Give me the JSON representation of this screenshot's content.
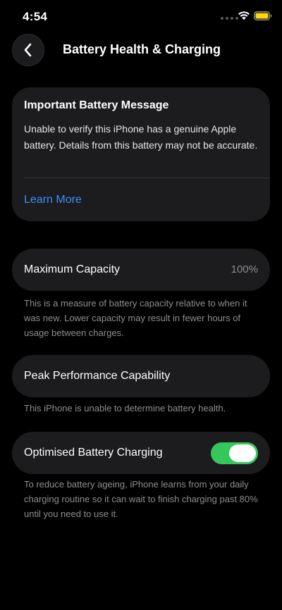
{
  "status_bar": {
    "time": "4:54",
    "wifi_icon": "wifi-icon",
    "battery_icon": "battery-icon",
    "battery_color": "#ffd60a"
  },
  "nav": {
    "back_icon": "chevron-left-icon",
    "title": "Battery Health & Charging"
  },
  "message": {
    "title": "Important Battery Message",
    "body": "Unable to verify this iPhone has a genuine Apple battery. Details from this battery may not be accurate.",
    "link": "Learn More"
  },
  "capacity": {
    "label": "Maximum Capacity",
    "value": "100%",
    "note": "This is a measure of battery capacity relative to when it was new. Lower capacity may result in fewer hours of usage between charges."
  },
  "peak": {
    "label": "Peak Performance Capability",
    "note": "This iPhone is unable to determine battery health."
  },
  "charging": {
    "label": "Optimised Battery Charging",
    "enabled": true,
    "note": "To reduce battery ageing, iPhone learns from your daily charging routine so it can wait to finish charging past 80% until you need to use it."
  },
  "colors": {
    "accent_link": "#3b8ff7",
    "toggle_on": "#34c759",
    "card_background": "#1c1c1e"
  }
}
